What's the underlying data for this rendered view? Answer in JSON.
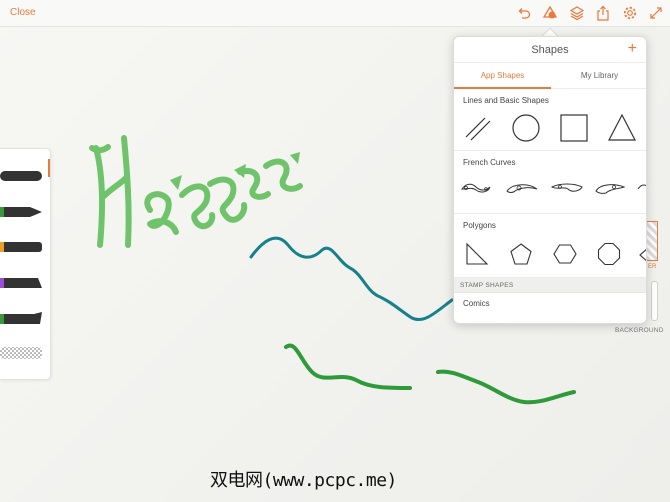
{
  "toolbar": {
    "close_label": "Close",
    "icons": [
      "undo-icon",
      "shapes-icon",
      "layers-icon",
      "share-icon",
      "settings-icon",
      "fullscreen-icon"
    ],
    "accent_color": "#e87a3c"
  },
  "brush_palette": {
    "brushes": [
      {
        "name": "brush-1",
        "color": "#333333"
      },
      {
        "name": "brush-2",
        "color": "#3a9a3a"
      },
      {
        "name": "brush-3",
        "color": "#e8a02a"
      },
      {
        "name": "brush-4",
        "color": "#9a4fd6"
      },
      {
        "name": "brush-5",
        "color": "#3a9a3a",
        "active": true
      },
      {
        "name": "eraser",
        "color": "#cccccc"
      }
    ]
  },
  "shapes_panel": {
    "title": "Shapes",
    "add_label": "+",
    "tabs": [
      {
        "label": "App Shapes",
        "active": true
      },
      {
        "label": "My Library",
        "active": false
      }
    ],
    "sections": [
      {
        "label": "Lines and Basic Shapes",
        "shapes": [
          "lines-shape-icon",
          "circle-shape-icon",
          "square-shape-icon",
          "triangle-shape-icon"
        ]
      },
      {
        "label": "French Curves",
        "shapes": [
          "french-curve-1-icon",
          "french-curve-2-icon",
          "french-curve-3-icon",
          "french-curve-4-icon",
          "french-curve-5-icon"
        ]
      },
      {
        "label": "Polygons",
        "shapes": [
          "right-triangle-icon",
          "pentagon-icon",
          "hexagon-icon",
          "octagon-icon",
          "polygon-partial-icon"
        ]
      }
    ],
    "stamp_header": "STAMP SHAPES",
    "stamp_section_label": "Comics"
  },
  "layers": {
    "layer_label": "ER",
    "background_label": "BACKGROUND"
  },
  "watermark": "双电网(www.pcpc.me)"
}
